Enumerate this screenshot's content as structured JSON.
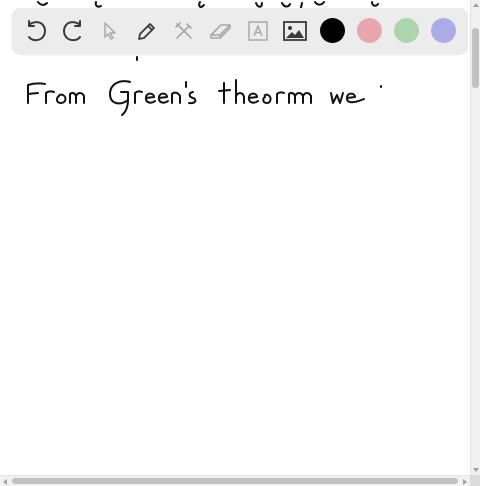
{
  "canvas": {
    "handwriting_line": "From Green's theorem we ."
  },
  "toolbar": {
    "tools": [
      {
        "name": "undo-icon",
        "enabled": true
      },
      {
        "name": "redo-icon",
        "enabled": true
      },
      {
        "name": "pointer-icon",
        "enabled": false
      },
      {
        "name": "pen-icon",
        "enabled": true
      },
      {
        "name": "tools-icon",
        "enabled": false
      },
      {
        "name": "eraser-icon",
        "enabled": false
      },
      {
        "name": "text-icon",
        "enabled": false
      },
      {
        "name": "image-icon",
        "enabled": true
      }
    ],
    "colors": {
      "black": "#000000",
      "pink": "#e8a6ae",
      "green": "#aed6ad",
      "blue": "#ababe8"
    },
    "icon_color": "#3a3a3a",
    "disabled_icon_color": "#a8a8a8"
  }
}
